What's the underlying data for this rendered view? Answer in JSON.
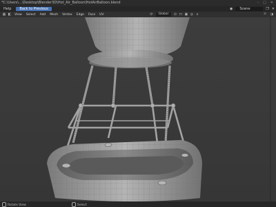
{
  "window": {
    "title": "*C:\\Users\\...\\Desktop\\Blender3D\\Hot_Air_Balloon\\HotAirBalloon.blend"
  },
  "topbar": {
    "menu": [
      "Help"
    ],
    "back_label": "Back to Previous",
    "scene_label": "Scene"
  },
  "header": {
    "items": [
      "View",
      "Select",
      "Add",
      "Mesh",
      "Vertex",
      "Edge",
      "Face",
      "UV"
    ],
    "orientation": "Global"
  },
  "status": {
    "left": "Rotate View",
    "right": "Select"
  },
  "colors": {
    "accent": "#4772b3",
    "viewport_bg": "#3a3a3a",
    "mesh": "#9c9c9c"
  }
}
